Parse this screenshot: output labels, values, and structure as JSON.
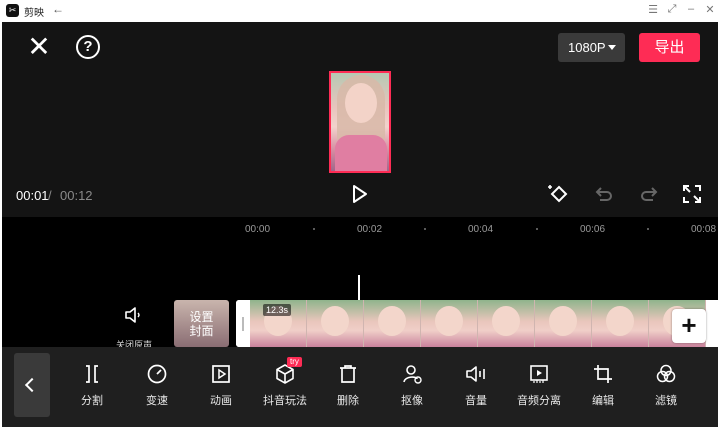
{
  "window": {
    "app_logo": "✂",
    "title": "剪映",
    "back_glyph": "←",
    "controls": [
      "☰",
      "⤢",
      "–",
      "✕"
    ]
  },
  "header": {
    "resolution": "1080P",
    "export_label": "导出"
  },
  "playback": {
    "current_time": "00:01",
    "separator": "/",
    "total_time": "00:12"
  },
  "ruler": {
    "labels": [
      "00:00",
      "00:02",
      "00:04",
      "00:06",
      "00:08"
    ]
  },
  "track": {
    "mute_label": "关闭原声",
    "cover_line1": "设置",
    "cover_line2": "封面",
    "clip_duration": "12.3s"
  },
  "toolbar": {
    "items": [
      {
        "label": "分割",
        "icon": "split-icon"
      },
      {
        "label": "变速",
        "icon": "speed-icon"
      },
      {
        "label": "动画",
        "icon": "animation-icon"
      },
      {
        "label": "抖音玩法",
        "icon": "cube-icon",
        "badge": "try"
      },
      {
        "label": "删除",
        "icon": "delete-icon"
      },
      {
        "label": "抠像",
        "icon": "cutout-icon"
      },
      {
        "label": "音量",
        "icon": "volume-icon"
      },
      {
        "label": "音频分离",
        "icon": "audio-separate-icon"
      },
      {
        "label": "编辑",
        "icon": "crop-icon"
      },
      {
        "label": "滤镜",
        "icon": "filter-icon"
      }
    ]
  },
  "colors": {
    "accent": "#fe2c55",
    "background": "#141414",
    "toolbar": "#1f1f1f"
  }
}
